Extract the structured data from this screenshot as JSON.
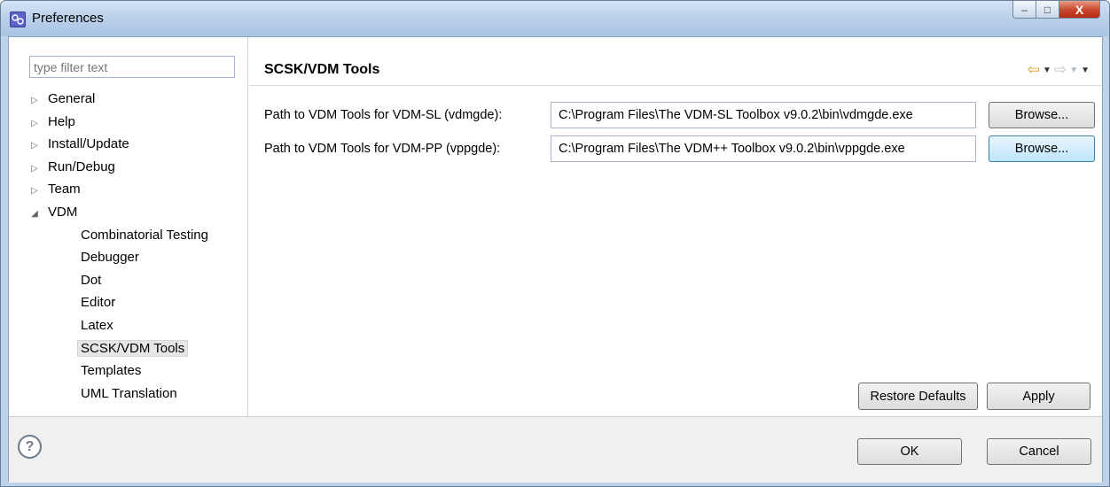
{
  "window": {
    "title": "Preferences",
    "icon": "preferences-app-icon",
    "controls": {
      "minimize": "‒",
      "maximize": "□",
      "close": "X"
    }
  },
  "sidebar": {
    "filter_placeholder": "type filter text",
    "items": [
      {
        "label": "General",
        "expanded": false,
        "level": 0
      },
      {
        "label": "Help",
        "expanded": false,
        "level": 0
      },
      {
        "label": "Install/Update",
        "expanded": false,
        "level": 0
      },
      {
        "label": "Run/Debug",
        "expanded": false,
        "level": 0
      },
      {
        "label": "Team",
        "expanded": false,
        "level": 0
      },
      {
        "label": "VDM",
        "expanded": true,
        "level": 0
      },
      {
        "label": "Combinatorial Testing",
        "level": 1
      },
      {
        "label": "Debugger",
        "level": 1
      },
      {
        "label": "Dot",
        "level": 1
      },
      {
        "label": "Editor",
        "level": 1
      },
      {
        "label": "Latex",
        "level": 1
      },
      {
        "label": "SCSK/VDM Tools",
        "level": 1,
        "selected": true
      },
      {
        "label": "Templates",
        "level": 1
      },
      {
        "label": "UML Translation",
        "level": 1
      }
    ],
    "twisty_collapsed": "▷",
    "twisty_expanded": "◢"
  },
  "page": {
    "title": "SCSK/VDM Tools",
    "nav": {
      "back": "⇦",
      "forward": "⇨",
      "dropdown": "▼",
      "menu": "▼"
    },
    "fields": [
      {
        "label": "Path to VDM Tools for VDM-SL (vdmgde):",
        "value": "C:\\Program Files\\The VDM-SL Toolbox v9.0.2\\bin\\vdmgde.exe",
        "browse_label": "Browse..."
      },
      {
        "label": "Path to VDM Tools for VDM-PP (vppgde):",
        "value": "C:\\Program Files\\The VDM++ Toolbox v9.0.2\\bin\\vppgde.exe",
        "browse_label": "Browse..."
      }
    ],
    "restore_defaults_label": "Restore Defaults",
    "apply_label": "Apply"
  },
  "footer": {
    "help_symbol": "?",
    "ok_label": "OK",
    "cancel_label": "Cancel"
  }
}
